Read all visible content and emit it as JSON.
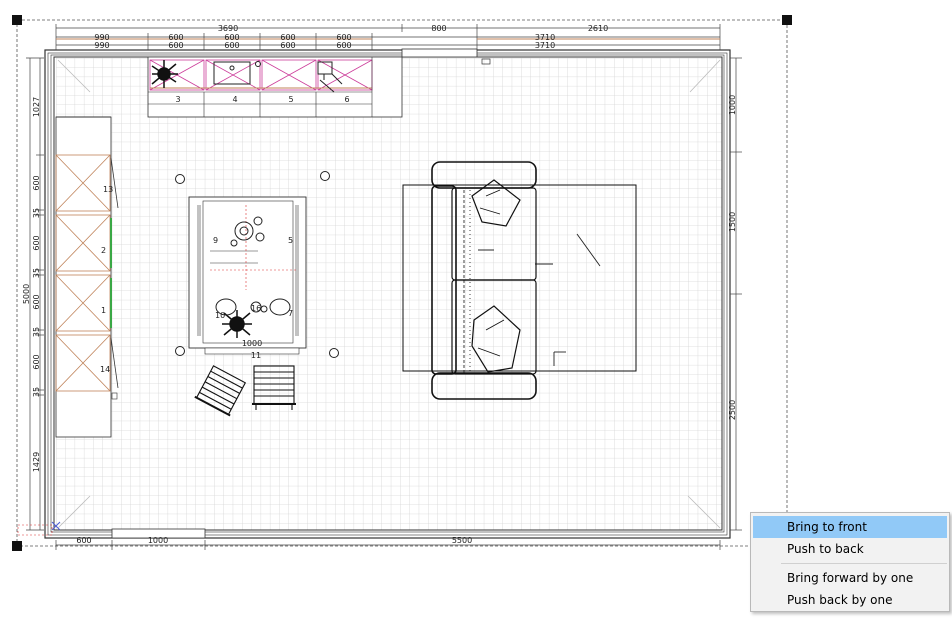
{
  "plan": {
    "top_dims_row1": [
      "3690",
      "800",
      "2610"
    ],
    "top_dims_row2": [
      "990",
      "600",
      "600",
      "600",
      "600",
      "3710"
    ],
    "top_dims_row3": [
      "990",
      "600",
      "600",
      "600",
      "600",
      "3710"
    ],
    "left_dims": [
      "1027",
      "600",
      "35",
      "600",
      "35",
      "600",
      "35",
      "600",
      "35",
      "1429"
    ],
    "left_total": "5000",
    "right_dims": [
      "1000",
      "1500",
      "2500"
    ],
    "bottom_dims": [
      "600",
      "1000",
      "5500"
    ],
    "counter_labels": [
      "3",
      "4",
      "5",
      "6"
    ],
    "side_labels": [
      "13",
      "2",
      "1",
      "14"
    ],
    "island_labels": [
      "9",
      "5",
      "10",
      "16",
      "7",
      "1000",
      "11"
    ]
  },
  "context_menu": {
    "items": [
      "Bring to front",
      "Push to back",
      "Bring forward by one",
      "Push back by one"
    ]
  },
  "colors": {
    "grid": "#d6d6d6",
    "wall": "#333333",
    "menu_highlight": "#91c9f7",
    "cabinet_cross": "#cc3d9a",
    "side_cabinet_line": "#c0835a"
  }
}
